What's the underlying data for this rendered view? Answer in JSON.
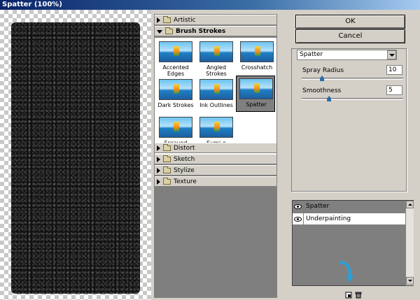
{
  "window": {
    "title": "Spatter (100%)"
  },
  "gallery": {
    "categories": {
      "artistic": "Artistic",
      "brush_strokes": "Brush Strokes",
      "distort": "Distort",
      "sketch": "Sketch",
      "stylize": "Stylize",
      "texture": "Texture"
    },
    "thumbnails": [
      {
        "label": "Accented Edges"
      },
      {
        "label": "Angled Strokes"
      },
      {
        "label": "Crosshatch"
      },
      {
        "label": "Dark Strokes"
      },
      {
        "label": "Ink Outlines"
      },
      {
        "label": "Spatter"
      },
      {
        "label": "Sprayed Strokes"
      },
      {
        "label": "Sumi-e"
      }
    ],
    "selected": "Spatter"
  },
  "buttons": {
    "ok": "OK",
    "cancel": "Cancel"
  },
  "settings": {
    "filter": "Spatter",
    "spray_radius": {
      "label": "Spray Radius",
      "value": "10",
      "fraction": 0.2
    },
    "smoothness": {
      "label": "Smoothness",
      "value": "5",
      "fraction": 0.27
    }
  },
  "layers": [
    {
      "name": "Spatter"
    },
    {
      "name": "Underpainting"
    }
  ],
  "colors": {
    "accent": "#2a6aa8",
    "gallery_bg": "#7f7f7f",
    "dialog_bg": "#d4d0c8"
  }
}
